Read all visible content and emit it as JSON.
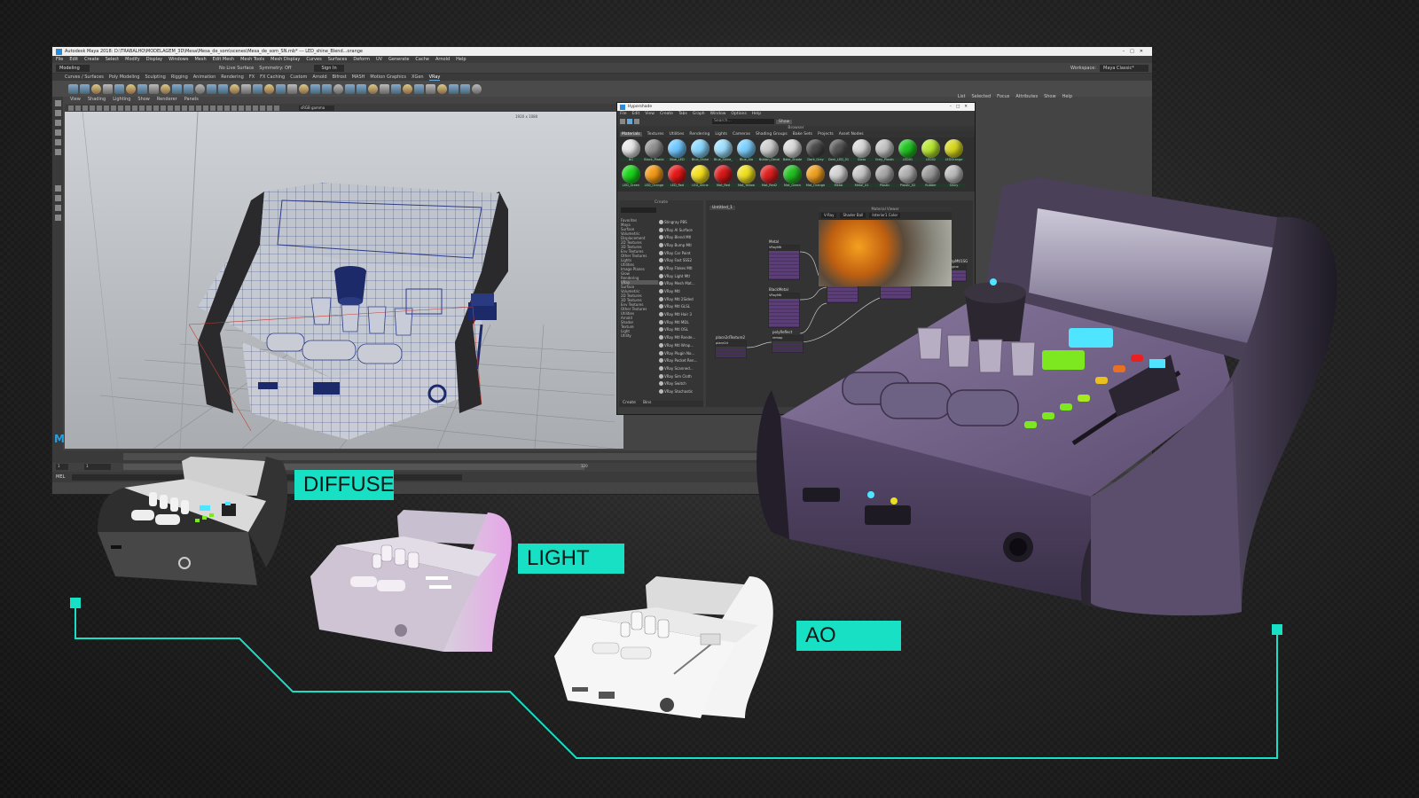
{
  "maya": {
    "title": "Autodesk Maya 2018: D:\\TRABALHO\\MODELAGEM_3D\\Mesa\\Mesa_de_som\\scenes\\Mesa_de_som_SN.mb* --- LED_shine_Blend...orange",
    "menus": [
      "File",
      "Edit",
      "Create",
      "Select",
      "Modify",
      "Display",
      "Windows",
      "Mesh",
      "Edit Mesh",
      "Mesh Tools",
      "Mesh Display",
      "Curves",
      "Surfaces",
      "Deform",
      "UV",
      "Generate",
      "Cache",
      "Arnold",
      "Help"
    ],
    "mode": "Modeling",
    "no_live_surface": "No Live Surface",
    "symmetry": "Symmetry: Off",
    "sign_in": "Sign In",
    "workspace_label": "Workspace:",
    "workspace_value": "Maya Classic*",
    "shelf_tabs": [
      "Curves / Surfaces",
      "Poly Modeling",
      "Sculpting",
      "Rigging",
      "Animation",
      "Rendering",
      "FX",
      "FX Caching",
      "Custom",
      "Arnold",
      "Bifrost",
      "MASH",
      "Motion Graphics",
      "XGen",
      "VRay"
    ],
    "shelf_active": "VRay",
    "panel_menu": [
      "View",
      "Shading",
      "Lighting",
      "Show",
      "Renderer",
      "Panels"
    ],
    "right_menu": [
      "List",
      "Selected",
      "Focus",
      "Attributes",
      "Show",
      "Help"
    ],
    "gamma": "sRGB gamma",
    "resolution": "1920 x 1080",
    "range_start": "1",
    "range_field": "1",
    "range_end": "120",
    "mel_label": "MEL"
  },
  "hypershade": {
    "title": "Hypershade",
    "menus": [
      "File",
      "Edit",
      "View",
      "Create",
      "Tabs",
      "Graph",
      "Window",
      "Options",
      "Help"
    ],
    "browser_title": "Browser",
    "tabs": [
      "Materials",
      "Textures",
      "Utilities",
      "Rendering",
      "Lights",
      "Cameras",
      "Shading Groups",
      "Bake Sets",
      "Projects",
      "Asset Nodes"
    ],
    "search_placeholder": "Search...",
    "show_label": "Show",
    "materials": [
      {
        "name": "BG",
        "color": "#e8e8e8"
      },
      {
        "name": "Black_Plastic",
        "color": "#909090"
      },
      {
        "name": "Blue_LED",
        "color": "#6ec8ff"
      },
      {
        "name": "Blue_Shine",
        "color": "#8ad8ff"
      },
      {
        "name": "Blue_Shine_",
        "color": "#9ee0ff"
      },
      {
        "name": "Blue_Ala",
        "color": "#7cd0ff"
      },
      {
        "name": "Button_Decal",
        "color": "#cfcfcf"
      },
      {
        "name": "Bake_Shade",
        "color": "#dadada"
      },
      {
        "name": "Dark_Grey",
        "color": "#4a4a4a"
      },
      {
        "name": "Dark_LED_01",
        "color": "#555555"
      },
      {
        "name": "Glass",
        "color": "#d8d8d8"
      },
      {
        "name": "Grey_Plastic",
        "color": "#c4c4c4"
      },
      {
        "name": "LED01",
        "color": "#22c422"
      },
      {
        "name": "LED02",
        "color": "#b8e830"
      },
      {
        "name": "LEDOrange",
        "color": "#d8d820"
      },
      {
        "name": "LED_Green",
        "color": "#1bd61b"
      },
      {
        "name": "LED_Orange",
        "color": "#f29a18"
      },
      {
        "name": "LED_Red",
        "color": "#e81818"
      },
      {
        "name": "LED_Shine",
        "color": "#f5e020"
      },
      {
        "name": "Mat_Red",
        "color": "#d81818"
      },
      {
        "name": "Mat_Yellow",
        "color": "#f0e020"
      },
      {
        "name": "Mat_Red2",
        "color": "#e02020"
      },
      {
        "name": "Mat_Green",
        "color": "#22c022"
      },
      {
        "name": "Mat_Orange",
        "color": "#f0a020"
      },
      {
        "name": "Metal",
        "color": "#d4d4d4"
      },
      {
        "name": "Metal_02",
        "color": "#c8c8c8"
      },
      {
        "name": "Plastic",
        "color": "#a8a8a8"
      },
      {
        "name": "Plastic_02",
        "color": "#b0b0b0"
      },
      {
        "name": "Rubber",
        "color": "#9a9a9a"
      },
      {
        "name": "Shiny",
        "color": "#bcbcbc"
      }
    ],
    "create_title": "Create",
    "create_tree": [
      "Favorites",
      "Maya",
      "Surface",
      "Volumetric",
      "Displacement",
      "2D Textures",
      "3D Textures",
      "Env Textures",
      "Other Textures",
      "Lights",
      "Utilities",
      "Image Planes",
      "Glow",
      "Rendering",
      "VRay",
      "Surface",
      "Volumetric",
      "2D Textures",
      "3D Textures",
      "Env Textures",
      "Other Textures",
      "Utilities",
      "Arnold",
      "Shader",
      "Texture",
      "Light",
      "Utility"
    ],
    "create_nodes": [
      "Stingray PBS",
      "VRay Al Surface",
      "VRay Blend Mtl",
      "VRay Bump Mtl",
      "VRay Car Paint",
      "VRay Fast SSS2",
      "VRay Flakes Mtl",
      "VRay Light Mtl",
      "VRay Mesh Mat...",
      "VRay Mtl",
      "VRay Mtl 2Sided",
      "VRay Mtl GLSL",
      "VRay Mtl Hair 3",
      "VRay Mtl MDL",
      "VRay Mtl OSL",
      "VRay Mtl Rende...",
      "VRay Mtl Wrap...",
      "VRay Plugin No...",
      "VRay Pocket Ren...",
      "VRay Scanned...",
      "VRay Sim Cloth",
      "VRay Switch",
      "VRay Stochastic"
    ],
    "create_footer": [
      "Create",
      "Bins"
    ],
    "graph_tab": "Untitled_1",
    "graph_nodes": [
      {
        "name": "Metal",
        "sub": "VRayMtl"
      },
      {
        "name": "BlackMetal",
        "sub": "VRayMtl"
      },
      {
        "name": "place2dTexture2",
        "sub": "place2d"
      },
      {
        "name": "polyReflect",
        "sub": "remap"
      },
      {
        "name": "Mix_blend_button",
        "sub": "VRayBlendMtl"
      },
      {
        "name": "Mix_Bump_Button",
        "sub": "VRayBumpMtl"
      },
      {
        "name": "VRayBumpMtl1SG",
        "sub": "shadingEngine"
      }
    ],
    "material_viewer_title": "Material Viewer",
    "viewer_renderer": "V-Ray",
    "viewer_shape": "Shader Ball",
    "viewer_env": "Interior1 Color"
  },
  "labels": {
    "diffuse": "DIFFUSE",
    "light": "LIGHT",
    "ao": "AO"
  },
  "colors": {
    "accent": "#18e0c4",
    "body_purple": "#6c5a84",
    "led_green": "#7de81f",
    "led_cyan": "#4fe4ff"
  }
}
